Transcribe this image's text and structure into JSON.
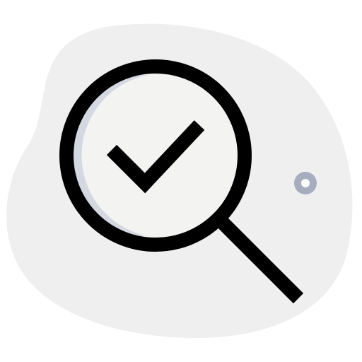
{
  "icon": {
    "name": "search-check-icon",
    "colors": {
      "background_blob": "#efefef",
      "lens_fill": "#f3f3f1",
      "lens_shadow": "#d3d8e1",
      "stroke": "#000000",
      "dot_ring": "#a6adbf",
      "dot_center": "#ffffff"
    }
  }
}
